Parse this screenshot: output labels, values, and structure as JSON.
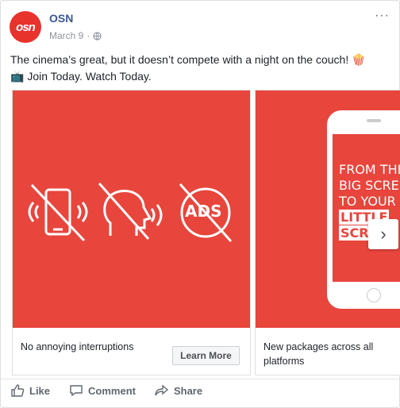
{
  "post": {
    "page_name": "OSN",
    "avatar_text": "osn",
    "date": "March 9",
    "more_label": "···",
    "text_line1": "The cinema’s great, but it doesn’t compete with a night on the couch! 🍿",
    "text_line2": "📺 Join Today. Watch Today."
  },
  "cards": [
    {
      "caption": "No annoying interruptions",
      "cta": "Learn More",
      "icon_text": "ADS"
    },
    {
      "caption_line1": "New packages across all",
      "caption_line2": "platforms",
      "tagline": [
        "FROM THE",
        "BIG SCREE",
        "TO YOUR",
        "LITTLE",
        "SCRE"
      ]
    }
  ],
  "actions": {
    "like": "Like",
    "comment": "Comment",
    "share": "Share"
  },
  "colors": {
    "brand_red": "#e8453c",
    "link_blue": "#385898"
  }
}
